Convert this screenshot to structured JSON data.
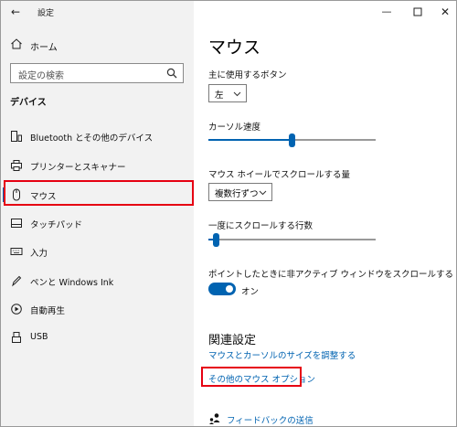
{
  "window": {
    "title": "設定",
    "back_icon": "back-arrow-icon",
    "controls": [
      "minimize-icon",
      "maximize-icon",
      "close-icon"
    ]
  },
  "sidebar": {
    "home_label": "ホーム",
    "search_placeholder": "設定の検索",
    "section_header": "デバイス",
    "items": [
      {
        "label": "Bluetooth とその他のデバイス",
        "icon": "bluetooth-devices-icon"
      },
      {
        "label": "プリンターとスキャナー",
        "icon": "printer-icon"
      },
      {
        "label": "マウス",
        "icon": "mouse-icon",
        "selected": true
      },
      {
        "label": "タッチパッド",
        "icon": "touchpad-icon"
      },
      {
        "label": "入力",
        "icon": "keyboard-icon"
      },
      {
        "label": "ペンと Windows Ink",
        "icon": "pen-icon"
      },
      {
        "label": "自動再生",
        "icon": "autoplay-icon"
      },
      {
        "label": "USB",
        "icon": "usb-icon"
      }
    ]
  },
  "main": {
    "title": "マウス",
    "primary_button": {
      "label": "主に使用するボタン",
      "value": "左"
    },
    "cursor_speed": {
      "label": "カーソル速度",
      "level": 0.5
    },
    "wheel_scroll": {
      "label": "マウス ホイールでスクロールする量",
      "value": "複数行ずつ"
    },
    "lines_to_scroll": {
      "label": "一度にスクロールする行数",
      "level": 0.03
    },
    "inactive_scroll": {
      "label": "ポイントしたときに非アクティブ ウィンドウをスクロールする",
      "state": "オン",
      "on": true
    },
    "related": {
      "header": "関連設定",
      "links": [
        "マウスとカーソルのサイズを調整する",
        "その他のマウス オプション"
      ]
    },
    "feedback": "フィードバックの送信"
  },
  "colors": {
    "accent": "#0063b1",
    "highlight": "#e60012",
    "sidebar_bg": "#f2f2f2"
  }
}
